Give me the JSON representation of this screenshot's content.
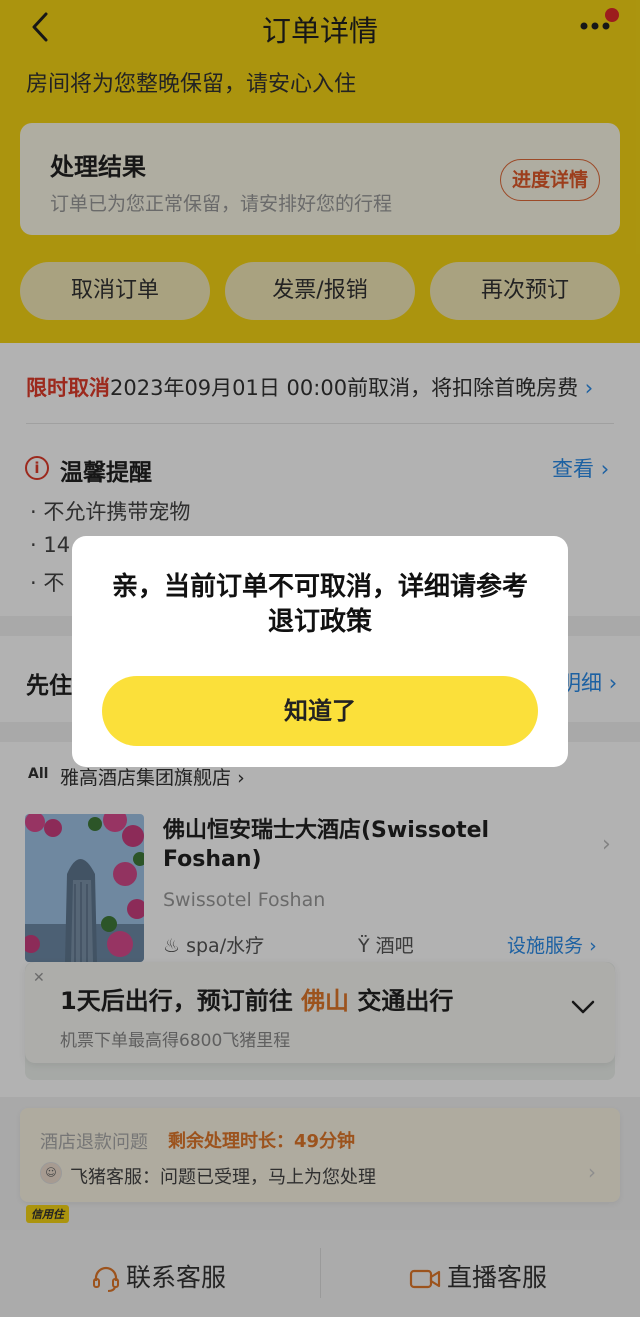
{
  "header": {
    "title": "订单详情",
    "notice": "房间将为您整晚保留，请安心入住"
  },
  "result": {
    "title": "处理结果",
    "subtitle": "订单已为您正常保留，请安排好您的行程",
    "progress_label": "进度详情"
  },
  "actions": [
    "取消订单",
    "发票/报销",
    "再次预订"
  ],
  "cancel_policy": {
    "tag": "限时取消",
    "text": "2023年09月01日 00:00前取消，将扣除首晚房费"
  },
  "tips": {
    "title": "温馨提醒",
    "view_label": "查看",
    "items": [
      "· 不允许携带宠物",
      "· 14",
      "· 不"
    ]
  },
  "live": {
    "title": "先住",
    "link": "明细"
  },
  "hotel": {
    "brand": "雅高酒店集团旗舰店",
    "brand_logo": "All",
    "name": "佛山恒安瑞士大酒店(Swissotel Foshan)",
    "name_en": "Swissotel Foshan",
    "facilities": [
      "spa/水疗",
      "酒吧"
    ],
    "facility_link": "设施服务"
  },
  "trip": {
    "prefix": "1天后出行，预订前往",
    "city": "佛山",
    "suffix": "交通出行",
    "sub": "机票下单最高得6800飞猪里程"
  },
  "refund": {
    "label": "酒店退款问题",
    "time_label": "剩余处理时长：49分钟",
    "message": "飞猪客服：问题已受理，马上为您处理",
    "badge": "信用住"
  },
  "bottom": {
    "service": "联系客服",
    "live_service": "直播客服"
  },
  "modal": {
    "message": "亲，当前订单不可取消，详细请参考退订政策",
    "confirm": "知道了"
  },
  "colors": {
    "accent": "#f5d515",
    "link": "#2a8be8",
    "warn": "#e03b2a",
    "orange": "#e0772a"
  }
}
